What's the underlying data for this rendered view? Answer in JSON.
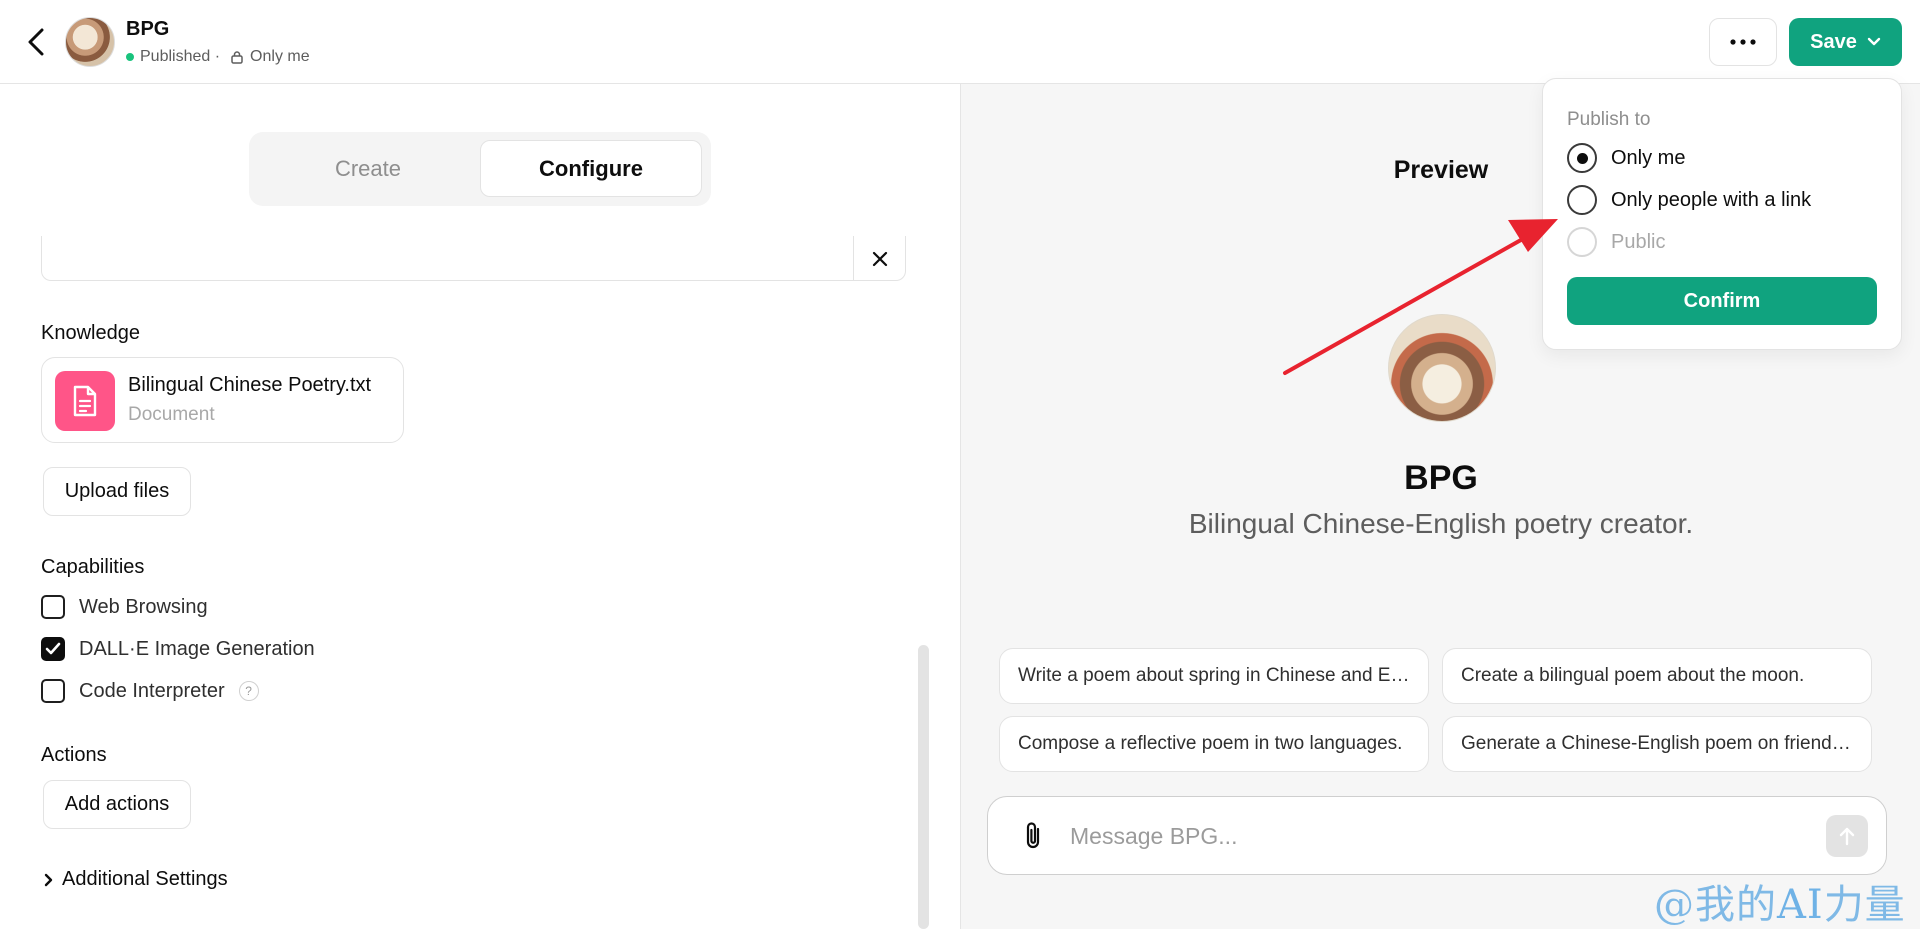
{
  "header": {
    "title": "BPG",
    "status_published": "Published ·",
    "status_visibility": "Only me",
    "save_label": "Save"
  },
  "left": {
    "tabs": {
      "create": "Create",
      "configure": "Configure"
    },
    "knowledge_label": "Knowledge",
    "file": {
      "name": "Bilingual Chinese Poetry.txt",
      "type": "Document"
    },
    "upload_label": "Upload files",
    "capabilities_label": "Capabilities",
    "capabilities": [
      {
        "label": "Web Browsing",
        "checked": false
      },
      {
        "label": "DALL·E Image Generation",
        "checked": true
      },
      {
        "label": "Code Interpreter",
        "checked": false
      }
    ],
    "help_glyph": "?",
    "actions_label": "Actions",
    "add_actions_label": "Add actions",
    "additional_settings_label": "Additional Settings"
  },
  "preview": {
    "title": "Preview",
    "bot_name": "BPG",
    "bot_description": "Bilingual Chinese-English poetry creator.",
    "suggestions": [
      "Write a poem about spring in Chinese and English.",
      "Create a bilingual poem about the moon.",
      "Compose a reflective poem in two languages.",
      "Generate a Chinese-English poem on friendship."
    ],
    "composer_placeholder": "Message BPG..."
  },
  "popover": {
    "title": "Publish to",
    "options": [
      {
        "label": "Only me",
        "selected": true,
        "disabled": false
      },
      {
        "label": "Only people with a link",
        "selected": false,
        "disabled": false
      },
      {
        "label": "Public",
        "selected": false,
        "disabled": true
      }
    ],
    "confirm_label": "Confirm"
  },
  "watermark": {
    "prefix": "@我的",
    "ai": "AI",
    "suffix": "力量"
  },
  "colors": {
    "accent": "#10a37f",
    "status_dot": "#19c37d",
    "file_icon": "#ff5588",
    "arrow": "#e8232f"
  }
}
